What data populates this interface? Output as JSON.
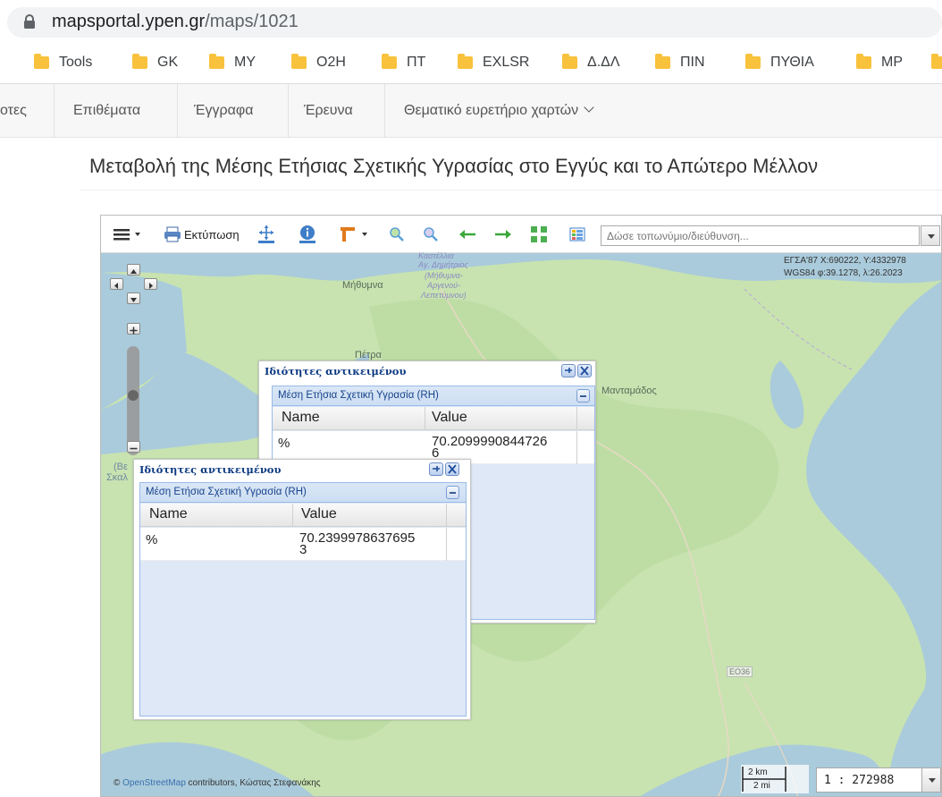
{
  "browser": {
    "url_domain": "mapsportal.ypen.gr",
    "url_path": "/maps/1021",
    "bookmarks": [
      "Tools",
      "GK",
      "MY",
      "O2H",
      "ΠΤ",
      "EXLSR",
      "Δ.ΔΛ",
      "ΠΙΝ",
      "ΠΥΘΙΑ",
      "MP"
    ]
  },
  "site_nav": {
    "items": [
      "οτες",
      "Επιθέματα",
      "Έγγραφα",
      "Έρευνα",
      "Θεματικό ευρετήριο χαρτών"
    ]
  },
  "page": {
    "title": "Μεταβολή της Μέσης Ετήσιας Σχετικής Υγρασίας στο Εγγύς και το Απώτερο Μέλλον"
  },
  "toolbar": {
    "print_label": "Εκτύπωση",
    "search_placeholder": "Δώσε τοπωνύμιο/διεύθυνση..."
  },
  "map": {
    "coords_line1": "ΕΓΣΑ'87 X:690222, Y:4332978",
    "coords_line2": "WGS84 φ:39.1278, λ:26.2023",
    "labels": {
      "kastellia": "Καστέλλια",
      "agios_dimitrios": "Αγ. Δημήτριος",
      "mithymna": "(Μήθυμνα-",
      "argenou": "Αργενού-",
      "lepetymnou": "Λεπετύμνου)",
      "methymna": "Μήθυμνα",
      "petra": "Πέτρα",
      "mantamados": "Μανταμάδος",
      "road": "ΕΟ36",
      "edge1": "(Βε",
      "edge2": "Σκαλ"
    },
    "attribution_link": "OpenStreetMap",
    "attribution_rest": " contributors, Κώστας Στεφανάκης",
    "scale_km": "2 km",
    "scale_mi": "2 mi",
    "scale_ratio": "1 : 272988"
  },
  "popup_back": {
    "title": "Ιδιότητες αντικειμένου",
    "panel_title": "Μέση Ετήσια Σχετική Υγρασία (RH)",
    "col_name": "Name",
    "col_value": "Value",
    "row_name": "%",
    "row_value_1": "70.2099990844726",
    "row_value_2": "6"
  },
  "popup_front": {
    "title": "Ιδιότητες αντικειμένου",
    "panel_title": "Μέση Ετήσια Σχετική Υγρασία (RH)",
    "col_name": "Name",
    "col_value": "Value",
    "row_name": "%",
    "row_value_1": "70.2399978637695",
    "row_value_2": "3"
  },
  "colors": {
    "land": "#c8e3b0",
    "land_dark": "#a9d19a",
    "sea": "#aacbdb",
    "panel_bg": "#dfe8f6",
    "accent": "#3f7dc8"
  }
}
